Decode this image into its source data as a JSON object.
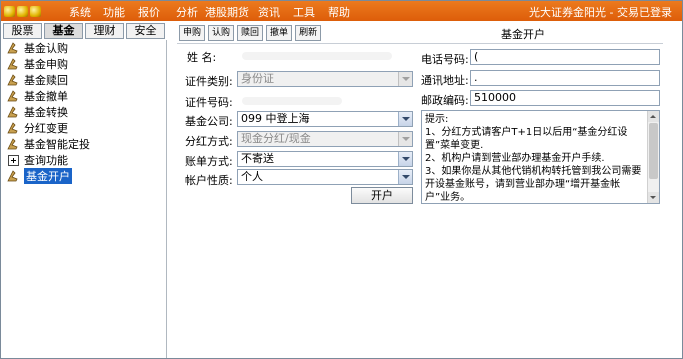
{
  "menubar": {
    "items": [
      "系统",
      "功能",
      "报价",
      "分析",
      "港股期货",
      "资讯",
      "工具",
      "帮助"
    ],
    "title": "光大证券金阳光 - 交易已登录"
  },
  "left_tabs": [
    "股票",
    "基金",
    "理财",
    "安全"
  ],
  "tree": [
    {
      "label": "基金认购",
      "icon": "fund-icon"
    },
    {
      "label": "基金申购",
      "icon": "fund-icon"
    },
    {
      "label": "基金赎回",
      "icon": "fund-icon"
    },
    {
      "label": "基金撤单",
      "icon": "fund-icon"
    },
    {
      "label": "基金转换",
      "icon": "fund-icon"
    },
    {
      "label": "分红变更",
      "icon": "fund-icon"
    },
    {
      "label": "基金智能定投",
      "icon": "fund-icon"
    },
    {
      "label": "查询功能",
      "icon": "expand-icon"
    },
    {
      "label": "基金开户",
      "icon": "fund-icon",
      "selected": true
    }
  ],
  "toolbar": [
    "申购",
    "认购",
    "赎回",
    "撤单",
    "刷新"
  ],
  "form_title": "基金开户",
  "form": {
    "name_label": "姓    名:",
    "id_type_label": "证件类别:",
    "id_type_value": "身份证",
    "id_number_label": "证件号码:",
    "fund_company_label": "基金公司:",
    "fund_company_value": "099  中登上海",
    "dividend_label": "分红方式:",
    "dividend_value": "现金分红/现金",
    "statement_label": "账单方式:",
    "statement_value": "不寄送",
    "account_type_label": "帐户性质:",
    "account_type_value": "个人",
    "phone_label": "电话号码:",
    "phone_value": "(",
    "address_label": "通讯地址:",
    "address_value": ".",
    "postcode_label": "邮政编码:",
    "postcode_value": "510000",
    "open_button": "开户"
  },
  "tips": {
    "heading": "提示:",
    "line1": "1、分红方式请客户T+1日以后用“基金分红设置”菜单变更.",
    "line2": "2、机构户请到营业部办理基金开户手续.",
    "line3": "3、如果你是从其他代销机构转托管到我公司需要开设基金账号，请到营业部办理“增开基金帐户”业务。"
  }
}
